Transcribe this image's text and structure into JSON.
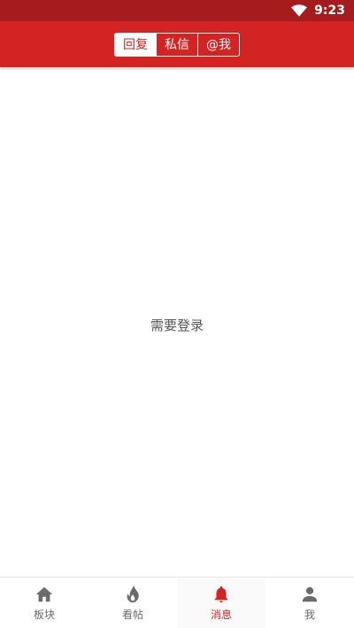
{
  "status_bar": {
    "time": "9:23",
    "wifi_icon": "wifi-icon"
  },
  "header": {
    "tabs": [
      {
        "label": "回复",
        "active": true
      },
      {
        "label": "私信",
        "active": false
      },
      {
        "label": "@我",
        "active": false
      }
    ]
  },
  "main": {
    "message": "需要登录"
  },
  "bottom_nav": {
    "items": [
      {
        "label": "板块",
        "icon": "home-icon",
        "active": false
      },
      {
        "label": "看帖",
        "icon": "flame-icon",
        "active": false
      },
      {
        "label": "消息",
        "icon": "bell-icon",
        "active": true
      },
      {
        "label": "我",
        "icon": "person-icon",
        "active": false
      }
    ]
  },
  "colors": {
    "primary": "#d32323",
    "status_bar": "#a61c1c",
    "inactive": "#6b6b6b"
  }
}
